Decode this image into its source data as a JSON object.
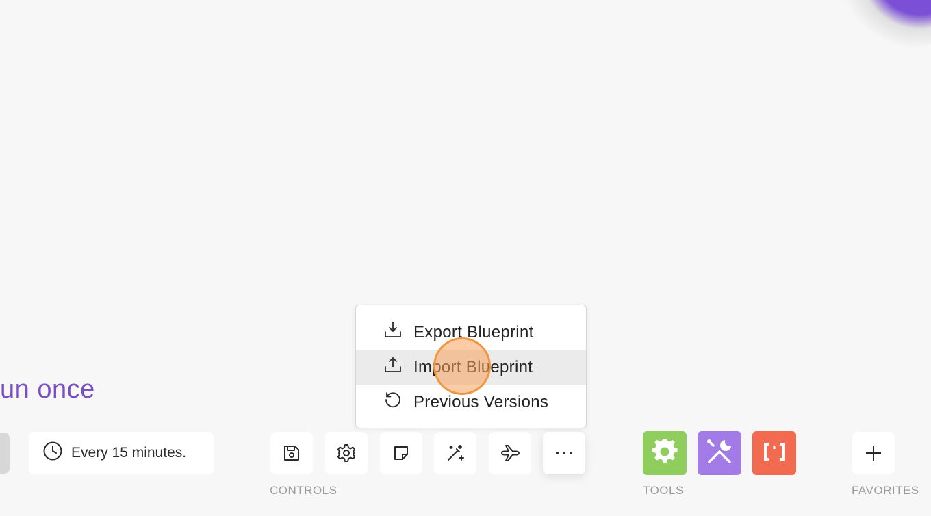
{
  "run_once_label": "un once",
  "schedule": {
    "label": "Every 15 minutes.",
    "icon": "clock-icon"
  },
  "controls": {
    "section_label": "CONTROLS",
    "buttons": [
      {
        "name": "save",
        "icon": "save-icon"
      },
      {
        "name": "settings",
        "icon": "gear-icon"
      },
      {
        "name": "notes",
        "icon": "note-icon"
      },
      {
        "name": "auto-align",
        "icon": "magic-wand-icon"
      },
      {
        "name": "explain-flow",
        "icon": "airplane-icon"
      },
      {
        "name": "more",
        "icon": "ellipsis-icon"
      }
    ]
  },
  "tools": {
    "section_label": "TOOLS",
    "items": [
      {
        "name": "flow-control",
        "icon": "gear-icon",
        "color": "#8fce5c"
      },
      {
        "name": "tools",
        "icon": "wrench-screwdriver-icon",
        "color": "#a37be6"
      },
      {
        "name": "text-parser",
        "icon": "brackets-icon",
        "color": "#f26b50"
      }
    ]
  },
  "favorites": {
    "section_label": "FAVORITES",
    "icon": "plus-icon"
  },
  "more_menu": {
    "items": [
      {
        "label": "Export Blueprint",
        "icon": "download-tray-icon"
      },
      {
        "label": "Import Blueprint",
        "icon": "upload-tray-icon",
        "hovered": true
      },
      {
        "label": "Previous Versions",
        "icon": "history-icon"
      }
    ]
  }
}
